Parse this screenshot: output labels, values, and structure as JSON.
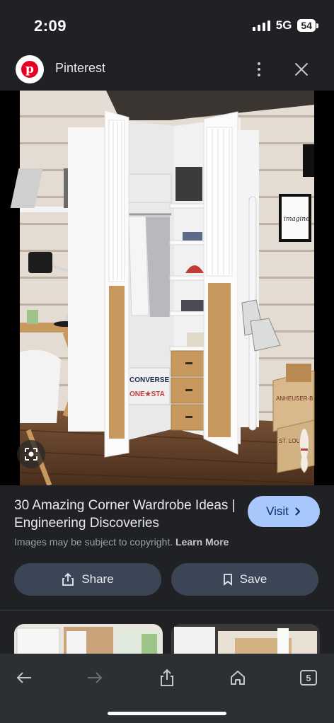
{
  "status_bar": {
    "time": "2:09",
    "network": "5G",
    "battery": "54"
  },
  "header": {
    "site_name": "Pinterest",
    "logo_letter": "p"
  },
  "image": {
    "alt": "Corner wardrobe",
    "poster_text": "imagine",
    "box_label_1": "CONVERSE",
    "box_label_2": "ONE★STA",
    "crate_label_1": "ANHEUSER-B",
    "crate_label_2": "ST. LOUIS"
  },
  "result": {
    "title": "30 Amazing Corner Wardrobe Ideas | Engineering Discoveries",
    "visit_label": "Visit",
    "copyright_text": "Images may be subject to copyright.",
    "learn_more": "Learn More"
  },
  "actions": {
    "share_label": "Share",
    "save_label": "Save"
  },
  "bottom_nav": {
    "tab_count": "5"
  },
  "colors": {
    "accent": "#a8c7fa",
    "pinterest_red": "#e60023",
    "button_bg": "#3c4556",
    "background": "#1f2124"
  }
}
